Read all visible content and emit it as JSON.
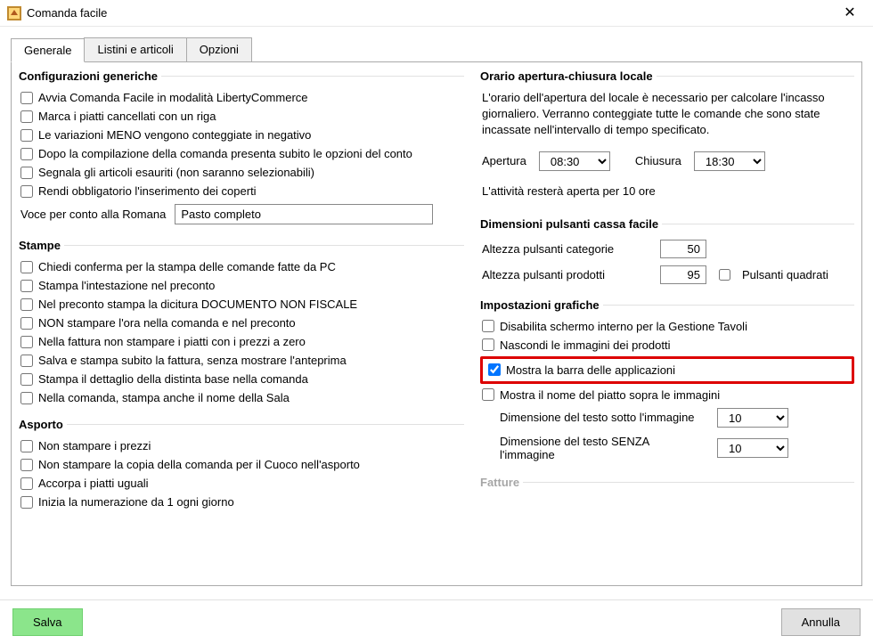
{
  "window": {
    "title": "Comanda facile"
  },
  "tabs": {
    "generale": "Generale",
    "listini": "Listini e articoli",
    "opzioni": "Opzioni"
  },
  "config": {
    "legend": "Configurazioni generiche",
    "avvia": "Avvia Comanda Facile in modalità LibertyCommerce",
    "marca": "Marca i piatti cancellati con un riga",
    "variazioni": "Le variazioni MENO vengono conteggiate in negativo",
    "dopo": "Dopo la compilazione della comanda presenta subito le opzioni del conto",
    "segnala": "Segnala gli articoli esauriti (non saranno selezionabili)",
    "rendi": "Rendi obbligatorio l'inserimento dei coperti",
    "voce_label": "Voce per conto alla Romana",
    "voce_value": "Pasto completo"
  },
  "stampe": {
    "legend": "Stampe",
    "conferma": "Chiedi conferma per la stampa delle comande fatte da PC",
    "intest": "Stampa l'intestazione nel preconto",
    "nonfisc": "Nel preconto stampa la dicitura DOCUMENTO NON FISCALE",
    "noora": "NON stampare l'ora nella comanda e nel preconto",
    "nofatt": "Nella fattura non stampare i piatti con i prezzi a zero",
    "salva": "Salva e stampa subito la fattura, senza mostrare l'anteprima",
    "dett": "Stampa il dettaglio della distinta base nella comanda",
    "sala": "Nella comanda, stampa anche il nome della Sala"
  },
  "asporto": {
    "legend": "Asporto",
    "noprezzi": "Non stampare i prezzi",
    "nocopia": "Non stampare la copia della comanda per il Cuoco nell'asporto",
    "accorpa": "Accorpa i piatti uguali",
    "numeraz": "Inizia la numerazione da 1 ogni giorno"
  },
  "orario": {
    "legend": "Orario apertura-chiusura locale",
    "note": "L'orario dell'apertura del locale è necessario per calcolare l'incasso giornaliero. Verranno conteggiate tutte le comande che sono state incassate nell'intervallo di tempo specificato.",
    "apertura_label": "Apertura",
    "apertura_value": "08:30",
    "chiusura_label": "Chiusura",
    "chiusura_value": "18:30",
    "rest": "L'attività resterà aperta per 10 ore"
  },
  "dimpuls": {
    "legend": "Dimensioni pulsanti cassa facile",
    "cat_label": "Altezza pulsanti categorie",
    "cat_value": "50",
    "prod_label": "Altezza pulsanti prodotti",
    "prod_value": "95",
    "quad": "Pulsanti quadrati"
  },
  "grafiche": {
    "legend": "Impostazioni grafiche",
    "disab": "Disabilita schermo interno per la Gestione Tavoli",
    "nasc": "Nascondi le immagini dei prodotti",
    "barra": "Mostra la barra delle applicazioni",
    "nome": "Mostra il nome del piatto sopra le immagini",
    "dimsotto_label": "Dimensione del testo sotto l'immagine",
    "dimsotto_value": "10",
    "dimsenza_label": "Dimensione del testo SENZA l'immagine",
    "dimsenza_value": "10"
  },
  "cutoff": "Fatture",
  "footer": {
    "salva": "Salva",
    "annulla": "Annulla"
  }
}
